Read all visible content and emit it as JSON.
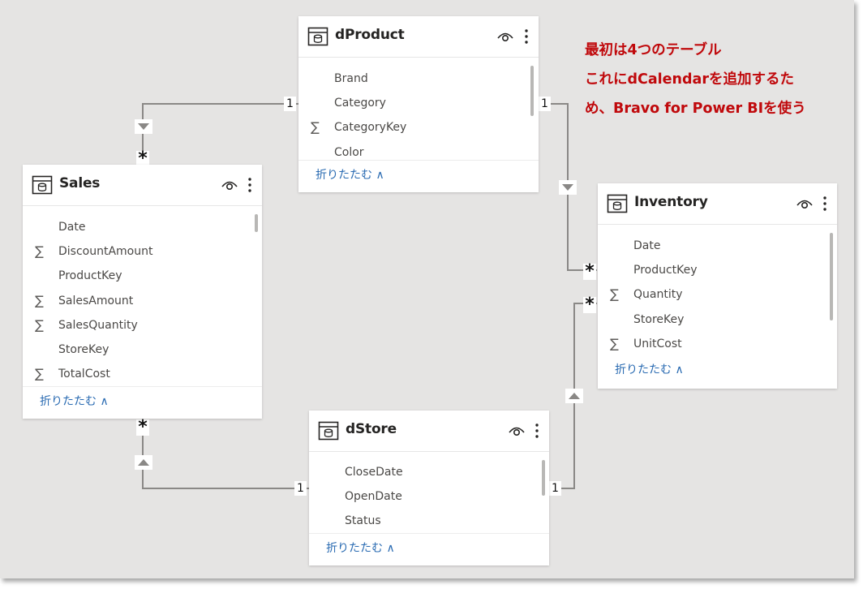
{
  "tables": [
    {
      "id": "dProduct",
      "title": "dProduct",
      "fields": [
        {
          "name": "Brand",
          "sum": false
        },
        {
          "name": "Category",
          "sum": false
        },
        {
          "name": "CategoryKey",
          "sum": true
        },
        {
          "name": "Color",
          "sum": false
        }
      ],
      "collapse_label": "折りたたむ ∧",
      "icons": {
        "table": "table-icon",
        "visibility": "eye-icon",
        "menu": "more-vertical-icon"
      }
    },
    {
      "id": "Sales",
      "title": "Sales",
      "fields": [
        {
          "name": "Date",
          "sum": false
        },
        {
          "name": "DiscountAmount",
          "sum": true
        },
        {
          "name": "ProductKey",
          "sum": false
        },
        {
          "name": "SalesAmount",
          "sum": true
        },
        {
          "name": "SalesQuantity",
          "sum": true
        },
        {
          "name": "StoreKey",
          "sum": false
        },
        {
          "name": "TotalCost",
          "sum": true
        }
      ],
      "collapse_label": "折りたたむ ∧",
      "icons": {
        "table": "table-icon",
        "visibility": "eye-icon",
        "menu": "more-vertical-icon"
      }
    },
    {
      "id": "Inventory",
      "title": "Inventory",
      "fields": [
        {
          "name": "Date",
          "sum": false
        },
        {
          "name": "ProductKey",
          "sum": false
        },
        {
          "name": "Quantity",
          "sum": true
        },
        {
          "name": "StoreKey",
          "sum": false
        },
        {
          "name": "UnitCost",
          "sum": true
        }
      ],
      "collapse_label": "折りたたむ ∧",
      "icons": {
        "table": "table-icon",
        "visibility": "eye-icon",
        "menu": "more-vertical-icon"
      }
    },
    {
      "id": "dStore",
      "title": "dStore",
      "fields": [
        {
          "name": "CloseDate",
          "sum": false
        },
        {
          "name": "OpenDate",
          "sum": false
        },
        {
          "name": "Status",
          "sum": false
        }
      ],
      "collapse_label": "折りたたむ ∧",
      "icons": {
        "table": "table-icon",
        "visibility": "eye-icon",
        "menu": "more-vertical-icon"
      }
    }
  ],
  "sum_symbol": "∑",
  "relationships": [
    {
      "from": "dProduct",
      "to": "Sales",
      "from_cardinality": "1",
      "to_cardinality": "*",
      "filter_direction": "down"
    },
    {
      "from": "dProduct",
      "to": "Inventory",
      "from_cardinality": "1",
      "to_cardinality": "*",
      "filter_direction": "down"
    },
    {
      "from": "dStore",
      "to": "Sales",
      "from_cardinality": "1",
      "to_cardinality": "*",
      "filter_direction": "up"
    },
    {
      "from": "dStore",
      "to": "Inventory",
      "from_cardinality": "1",
      "to_cardinality": "*",
      "filter_direction": "up"
    }
  ],
  "annotation": {
    "lines": [
      "最初は4つのテーブル",
      "これにdCalendarを追加するた",
      "め、Bravo for Power BIを使う"
    ],
    "color": "#c0090c"
  },
  "colors": {
    "canvas": "#e5e4e3",
    "link": "#2a6bb2",
    "line": "#8a8886"
  }
}
